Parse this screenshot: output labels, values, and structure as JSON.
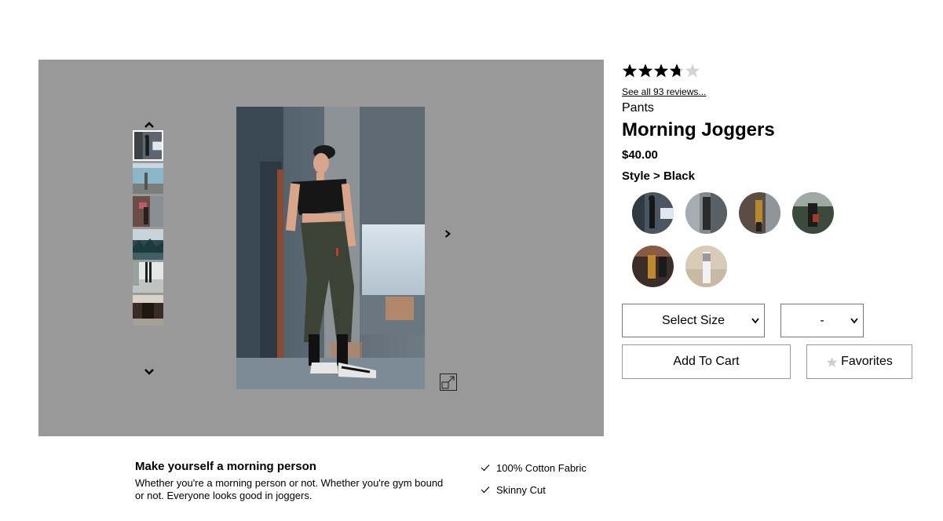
{
  "gallery": {
    "up_icon": "chevron-up-icon",
    "down_icon": "chevron-down-icon",
    "next_icon": "chevron-right-icon",
    "expand_icon": "expand-icon",
    "thumbnail_count": 6,
    "active_thumbnail": 1
  },
  "rating": {
    "stars": 3.75,
    "max": 5,
    "reviews_link": "See all 93 reviews..."
  },
  "product": {
    "category": "Pants",
    "name": "Morning Joggers",
    "price": "$40.00",
    "style_label": "Style > Black",
    "style_count": 6,
    "selected_style": 1
  },
  "controls": {
    "size_select": "Select Size",
    "qty_select": "-",
    "add_to_cart": "Add To Cart",
    "favorites": "Favorites"
  },
  "description": {
    "headline": "Make yourself a morning person",
    "body": "Whether you're a morning person or not. Whether you're gym bound or not. Everyone looks good in joggers."
  },
  "features": [
    "100% Cotton Fabric",
    "Skinny Cut"
  ],
  "colors": {
    "gallery_bg": "#999999",
    "star_filled": "#000000",
    "star_empty": "#d3d3d3"
  }
}
